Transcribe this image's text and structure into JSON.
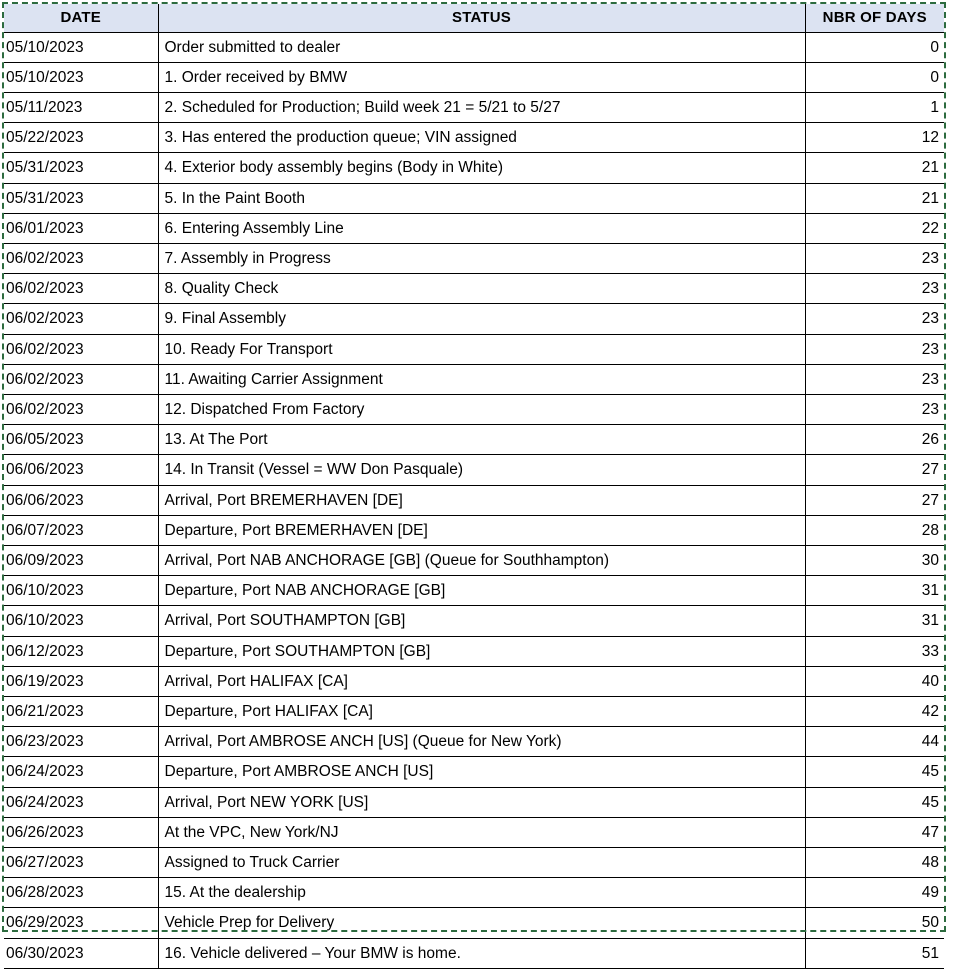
{
  "app": {
    "type": "spreadsheet-table",
    "selection_marquee": true
  },
  "colors": {
    "header_background": "#DCE3F2",
    "header_text": "#000000",
    "grid_line": "#000000",
    "cell_background": "#FFFFFF",
    "cell_text": "#000000",
    "selection_border": "#2D6B3F"
  },
  "table": {
    "columns": [
      {
        "key": "date",
        "label": "DATE",
        "align": "left"
      },
      {
        "key": "status",
        "label": "STATUS",
        "align": "left"
      },
      {
        "key": "days",
        "label": "NBR OF DAYS",
        "align": "right"
      }
    ],
    "rows": [
      {
        "date": "05/10/2023",
        "status": "Order submitted to dealer",
        "days": "0"
      },
      {
        "date": "05/10/2023",
        "status": "1. Order received by BMW",
        "days": "0"
      },
      {
        "date": "05/11/2023",
        "status": "2. Scheduled for Production; Build week 21 = 5/21 to 5/27",
        "days": "1"
      },
      {
        "date": "05/22/2023",
        "status": "3. Has entered the production queue; VIN assigned",
        "days": "12"
      },
      {
        "date": "05/31/2023",
        "status": "4. Exterior body assembly begins (Body in White)",
        "days": "21"
      },
      {
        "date": "05/31/2023",
        "status": "5. In the Paint Booth",
        "days": "21"
      },
      {
        "date": "06/01/2023",
        "status": "6. Entering Assembly Line",
        "days": "22"
      },
      {
        "date": "06/02/2023",
        "status": "7. Assembly in Progress",
        "days": "23"
      },
      {
        "date": "06/02/2023",
        "status": "8. Quality Check",
        "days": "23"
      },
      {
        "date": "06/02/2023",
        "status": "9. Final Assembly",
        "days": "23"
      },
      {
        "date": "06/02/2023",
        "status": "10. Ready For Transport",
        "days": "23"
      },
      {
        "date": "06/02/2023",
        "status": "11. Awaiting Carrier Assignment",
        "days": "23"
      },
      {
        "date": "06/02/2023",
        "status": "12. Dispatched From Factory",
        "days": "23"
      },
      {
        "date": "06/05/2023",
        "status": "13. At The Port",
        "days": "26"
      },
      {
        "date": "06/06/2023",
        "status": "14. In Transit (Vessel = WW Don Pasquale)",
        "days": "27"
      },
      {
        "date": "06/06/2023",
        "status": "Arrival, Port BREMERHAVEN [DE]",
        "days": "27"
      },
      {
        "date": "06/07/2023",
        "status": "Departure, Port BREMERHAVEN [DE]",
        "days": "28"
      },
      {
        "date": "06/09/2023",
        "status": "Arrival, Port NAB ANCHORAGE [GB] (Queue for Southhampton)",
        "days": "30"
      },
      {
        "date": "06/10/2023",
        "status": "Departure, Port NAB ANCHORAGE [GB]",
        "days": "31"
      },
      {
        "date": "06/10/2023",
        "status": "Arrival, Port SOUTHAMPTON [GB]",
        "days": "31"
      },
      {
        "date": "06/12/2023",
        "status": "Departure, Port SOUTHAMPTON [GB]",
        "days": "33"
      },
      {
        "date": "06/19/2023",
        "status": "Arrival, Port HALIFAX [CA]",
        "days": "40"
      },
      {
        "date": "06/21/2023",
        "status": "Departure, Port HALIFAX [CA]",
        "days": "42"
      },
      {
        "date": "06/23/2023",
        "status": "Arrival, Port AMBROSE ANCH [US] (Queue for New York)",
        "days": "44"
      },
      {
        "date": "06/24/2023",
        "status": "Departure, Port AMBROSE ANCH [US]",
        "days": "45"
      },
      {
        "date": "06/24/2023",
        "status": "Arrival, Port NEW YORK [US]",
        "days": "45"
      },
      {
        "date": "06/26/2023",
        "status": "At the VPC, New York/NJ",
        "days": "47"
      },
      {
        "date": "06/27/2023",
        "status": "Assigned to Truck Carrier",
        "days": "48"
      },
      {
        "date": "06/28/2023",
        "status": "15. At the dealership",
        "days": "49"
      },
      {
        "date": "06/29/2023",
        "status": "Vehicle Prep for Delivery",
        "days": "50"
      },
      {
        "date": "06/30/2023",
        "status": "16. Vehicle delivered – Your BMW is home.",
        "days": "51"
      }
    ]
  }
}
